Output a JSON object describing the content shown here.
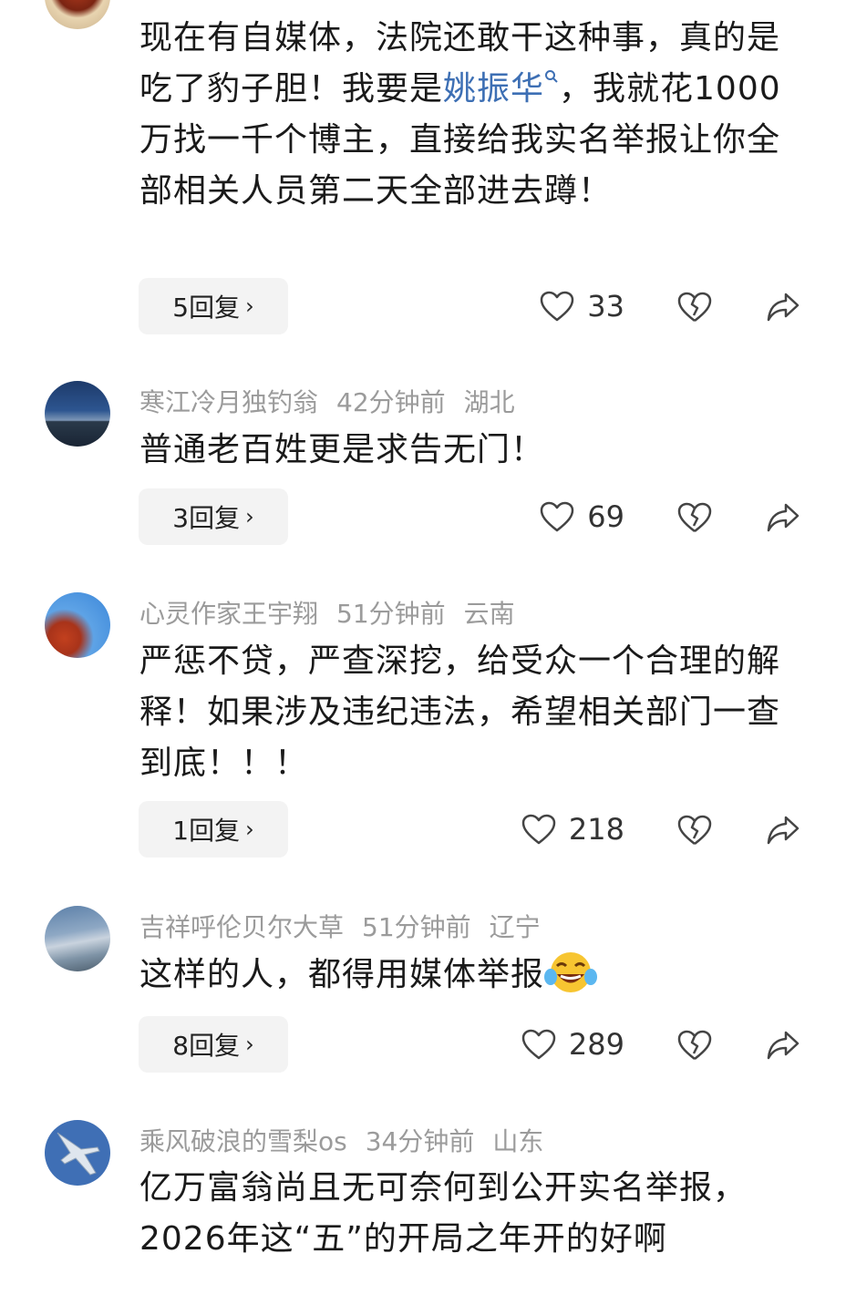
{
  "comments": [
    {
      "username": "",
      "time": "",
      "region": "",
      "text_parts": [
        "现在有自媒体，法院还敢干这种事，真的是吃了豹子胆！我要是",
        "姚振华",
        "，我就花1000万找一千个博主，直接给我实名举报让你全部相关人员第二天全部进去蹲！"
      ],
      "link_icon": "search-icon",
      "replies_label": "5回复",
      "likes": "33"
    },
    {
      "username": "寒江冷月独钓翁",
      "time": "42分钟前",
      "region": "湖北",
      "text": "普通老百姓更是求告无门！",
      "replies_label": "3回复",
      "likes": "69"
    },
    {
      "username": "心灵作家王宇翔",
      "time": "51分钟前",
      "region": "云南",
      "text": "严惩不贷，严查深挖，给受众一个合理的解释！如果涉及违纪违法，希望相关部门一查到底！！！",
      "replies_label": "1回复",
      "likes": "218"
    },
    {
      "username": "吉祥呼伦贝尔大草",
      "time": "51分钟前",
      "region": "辽宁",
      "text": "这样的人，都得用媒体举报",
      "emoji": "laughing-tears-emoji",
      "replies_label": "8回复",
      "likes": "289"
    },
    {
      "username": "乘风破浪的雪梨os",
      "time": "34分钟前",
      "region": "山东",
      "text": "亿万富翁尚且无可奈何到公开实名举报，2026年这“五”的开局之年开的好啊"
    }
  ],
  "colors": {
    "link": "#3d6fb4",
    "meta": "#9b9b9b",
    "reply_bg": "#f3f3f3"
  }
}
